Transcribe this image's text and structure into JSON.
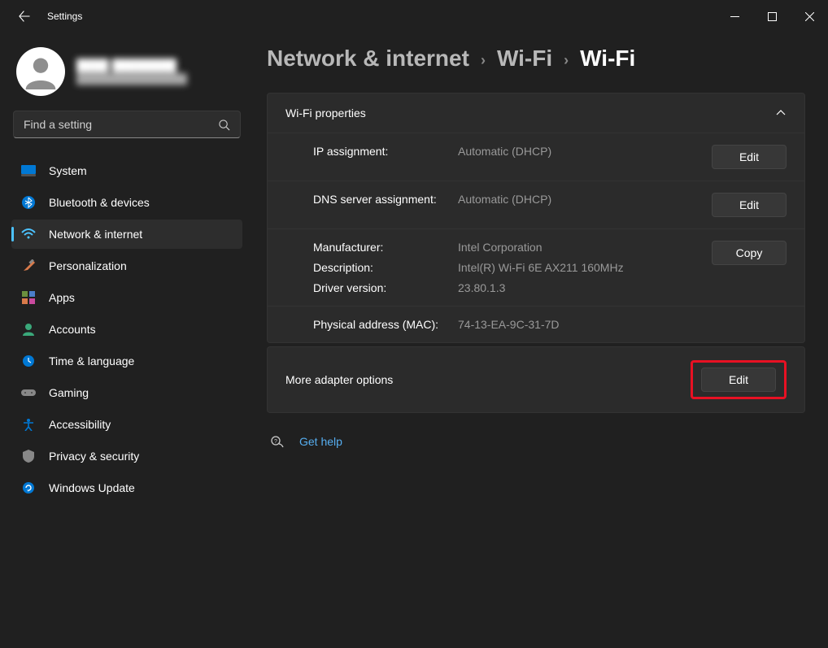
{
  "window": {
    "title": "Settings"
  },
  "profile": {
    "name": "████ ████████",
    "email": "████████████████"
  },
  "search": {
    "placeholder": "Find a setting"
  },
  "sidebar": {
    "items": [
      {
        "id": "system",
        "label": "System"
      },
      {
        "id": "bluetooth",
        "label": "Bluetooth & devices"
      },
      {
        "id": "network",
        "label": "Network & internet"
      },
      {
        "id": "personalization",
        "label": "Personalization"
      },
      {
        "id": "apps",
        "label": "Apps"
      },
      {
        "id": "accounts",
        "label": "Accounts"
      },
      {
        "id": "time",
        "label": "Time & language"
      },
      {
        "id": "gaming",
        "label": "Gaming"
      },
      {
        "id": "accessibility",
        "label": "Accessibility"
      },
      {
        "id": "privacy",
        "label": "Privacy & security"
      },
      {
        "id": "update",
        "label": "Windows Update"
      }
    ]
  },
  "breadcrumb": {
    "level0": "Network & internet",
    "level1": "Wi-Fi",
    "level2": "Wi-Fi"
  },
  "wifiProps": {
    "title": "Wi-Fi properties",
    "ipAssign": {
      "label": "IP assignment:",
      "value": "Automatic (DHCP)",
      "action": "Edit"
    },
    "dnsAssign": {
      "label": "DNS server assignment:",
      "value": "Automatic (DHCP)",
      "action": "Edit"
    },
    "hardware": {
      "manufacturerLabel": "Manufacturer:",
      "manufacturerValue": "Intel Corporation",
      "descriptionLabel": "Description:",
      "descriptionValue": "Intel(R) Wi-Fi 6E AX211 160MHz",
      "driverLabel": "Driver version:",
      "driverValue": "23.80.1.3",
      "action": "Copy"
    },
    "mac": {
      "label": "Physical address (MAC):",
      "value": "74-13-EA-9C-31-7D"
    }
  },
  "moreAdapter": {
    "label": "More adapter options",
    "action": "Edit"
  },
  "help": {
    "label": "Get help"
  }
}
